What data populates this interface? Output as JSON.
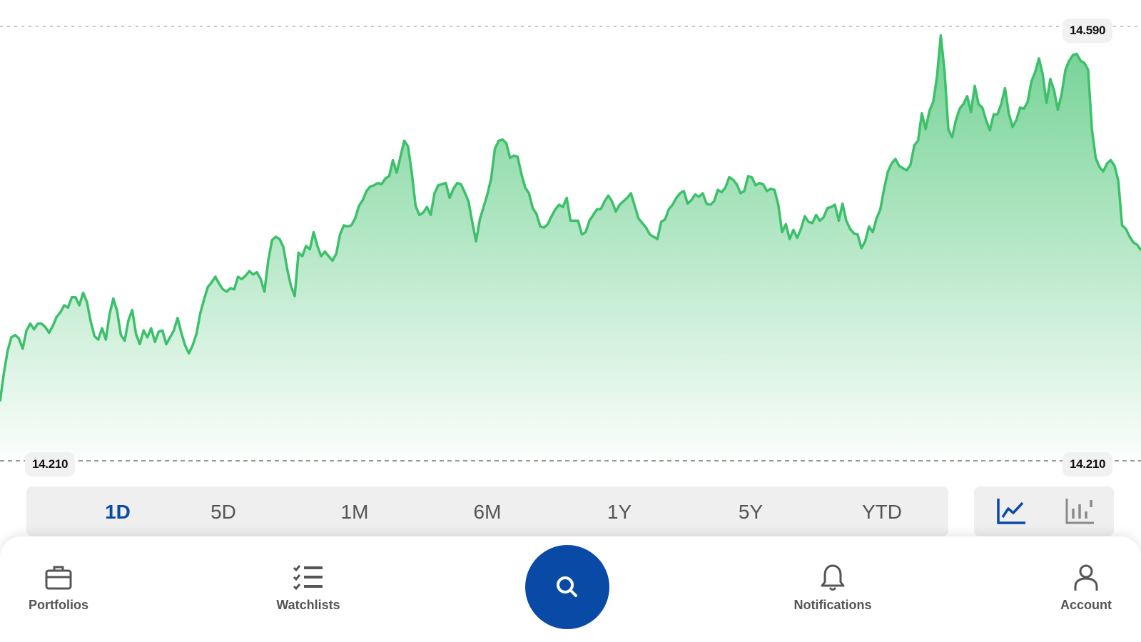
{
  "chart_data": {
    "type": "area",
    "x": [
      0,
      1,
      2,
      3,
      4,
      5,
      6,
      7,
      8,
      9,
      10,
      11,
      12,
      13,
      14,
      15,
      16,
      17,
      18,
      19,
      20,
      21,
      22,
      23,
      24,
      25,
      26,
      27,
      28,
      29,
      30,
      31,
      32,
      33,
      34,
      35,
      36,
      37,
      38,
      39,
      40,
      41,
      42,
      43,
      44,
      45,
      46,
      47,
      48,
      49,
      50,
      51,
      52,
      53,
      54,
      55,
      56,
      57,
      58,
      59,
      60,
      61,
      62,
      63,
      64,
      65,
      66,
      67,
      68,
      69,
      70,
      71,
      72,
      73,
      74,
      75,
      76,
      77,
      78,
      79,
      80,
      81,
      82,
      83,
      84,
      85,
      86,
      87,
      88,
      89,
      90,
      91,
      92,
      93,
      94,
      95,
      96,
      97,
      98,
      99,
      100,
      101,
      102,
      103,
      104,
      105,
      106,
      107,
      108,
      109,
      110,
      111,
      112,
      113,
      114,
      115,
      116,
      117,
      118,
      119,
      120,
      121,
      122,
      123,
      124,
      125,
      126,
      127,
      128,
      129,
      130,
      131,
      132,
      133,
      134,
      135,
      136,
      137,
      138,
      139,
      140,
      141,
      142,
      143,
      144,
      145,
      146,
      147,
      148,
      149,
      150,
      151,
      152,
      153,
      154,
      155,
      156,
      157,
      158,
      159,
      160,
      161,
      162,
      163,
      164,
      165,
      166,
      167,
      168,
      169,
      170,
      171,
      172,
      173,
      174,
      175,
      176,
      177,
      178,
      179,
      180,
      181,
      182,
      183,
      184,
      185,
      186,
      187,
      188,
      189,
      190,
      191,
      192,
      193,
      194,
      195,
      196,
      197,
      198,
      199,
      200,
      201,
      202,
      203,
      204,
      205,
      206,
      207,
      208,
      209,
      210,
      211,
      212,
      213,
      214,
      215,
      216,
      217,
      218,
      219,
      220,
      221,
      222,
      223,
      224,
      225,
      226,
      227,
      228,
      229,
      230,
      231,
      232,
      233,
      234,
      235,
      236,
      237,
      238,
      239,
      240,
      241,
      242,
      243,
      244,
      245,
      246,
      247,
      248,
      249,
      250,
      251,
      252,
      253,
      254,
      255,
      256,
      257,
      258,
      259,
      260,
      261,
      262,
      263,
      264,
      265,
      266,
      267,
      268,
      269,
      270,
      271,
      272,
      273,
      274,
      275,
      276,
      277,
      278,
      279,
      280,
      281,
      282,
      283,
      284,
      285,
      286,
      287,
      288,
      289,
      290,
      291,
      292,
      293,
      294,
      295,
      296,
      297,
      298,
      299
    ],
    "values": [
      14.262,
      14.286,
      14.306,
      14.318,
      14.32,
      14.317,
      14.308,
      14.324,
      14.33,
      14.325,
      14.33,
      14.33,
      14.327,
      14.322,
      14.328,
      14.336,
      14.34,
      14.346,
      14.344,
      14.353,
      14.353,
      14.346,
      14.357,
      14.349,
      14.332,
      14.319,
      14.316,
      14.326,
      14.316,
      14.338,
      14.352,
      14.341,
      14.32,
      14.315,
      14.333,
      14.342,
      14.321,
      14.312,
      14.324,
      14.318,
      14.326,
      14.314,
      14.323,
      14.324,
      14.312,
      14.318,
      14.324,
      14.335,
      14.322,
      14.311,
      14.304,
      14.311,
      14.321,
      14.339,
      14.351,
      14.362,
      14.366,
      14.371,
      14.365,
      14.36,
      14.358,
      14.361,
      14.36,
      14.371,
      14.369,
      14.372,
      14.376,
      14.373,
      14.375,
      14.369,
      14.358,
      14.385,
      14.403,
      14.406,
      14.404,
      14.397,
      14.378,
      14.363,
      14.354,
      14.392,
      14.389,
      14.398,
      14.395,
      14.41,
      14.398,
      14.389,
      14.393,
      14.389,
      14.385,
      14.391,
      14.408,
      14.416,
      14.415,
      14.416,
      14.422,
      14.433,
      14.438,
      14.446,
      14.45,
      14.451,
      14.453,
      14.452,
      14.457,
      14.459,
      14.473,
      14.462,
      14.476,
      14.49,
      14.485,
      14.462,
      14.433,
      14.425,
      14.427,
      14.432,
      14.425,
      14.444,
      14.451,
      14.452,
      14.453,
      14.44,
      14.448,
      14.453,
      14.452,
      14.445,
      14.437,
      14.419,
      14.402,
      14.421,
      14.432,
      14.443,
      14.457,
      14.483,
      14.49,
      14.491,
      14.488,
      14.475,
      14.477,
      14.476,
      14.461,
      14.449,
      14.444,
      14.431,
      14.426,
      14.415,
      14.414,
      14.417,
      14.424,
      14.43,
      14.434,
      14.432,
      14.44,
      14.42,
      14.42,
      14.42,
      14.408,
      14.41,
      14.42,
      14.425,
      14.43,
      14.43,
      14.437,
      14.442,
      14.437,
      14.428,
      14.434,
      14.437,
      14.44,
      14.444,
      14.433,
      14.422,
      14.418,
      14.414,
      14.408,
      14.406,
      14.404,
      14.419,
      14.421,
      14.43,
      14.434,
      14.44,
      14.444,
      14.446,
      14.435,
      14.438,
      14.443,
      14.441,
      14.444,
      14.435,
      14.434,
      14.437,
      14.447,
      14.445,
      14.449,
      14.458,
      14.456,
      14.452,
      14.444,
      14.446,
      14.459,
      14.458,
      14.451,
      14.453,
      14.452,
      14.446,
      14.448,
      14.447,
      14.434,
      14.41,
      14.417,
      14.404,
      14.412,
      14.405,
      14.413,
      14.424,
      14.419,
      14.418,
      14.425,
      14.42,
      14.423,
      14.431,
      14.432,
      14.434,
      14.42,
      14.435,
      14.42,
      14.413,
      14.409,
      14.408,
      14.396,
      14.402,
      14.415,
      14.41,
      14.422,
      14.43,
      14.448,
      14.463,
      14.47,
      14.474,
      14.468,
      14.466,
      14.464,
      14.469,
      14.486,
      14.49,
      14.514,
      14.5,
      14.516,
      14.524,
      14.546,
      14.582,
      14.551,
      14.5,
      14.493,
      14.508,
      14.518,
      14.522,
      14.529,
      14.515,
      14.538,
      14.522,
      14.519,
      14.508,
      14.499,
      14.513,
      14.513,
      14.522,
      14.536,
      14.514,
      14.502,
      14.508,
      14.519,
      14.518,
      14.524,
      14.542,
      14.55,
      14.562,
      14.548,
      14.523,
      14.544,
      14.534,
      14.517,
      14.531,
      14.552,
      14.56,
      14.565,
      14.566,
      14.56,
      14.558,
      14.552,
      14.5,
      14.475,
      14.467,
      14.463,
      14.47,
      14.473,
      14.468,
      14.455,
      14.416,
      14.413,
      14.406,
      14.401,
      14.399,
      14.394
    ],
    "ylim": [
      14.21,
      14.59
    ],
    "y_max_label": "14.590",
    "y_min_label": "14.210",
    "line_color": "#3cc06a",
    "fill_color": "#3cc06a"
  },
  "range_selector": {
    "items": [
      "1D",
      "5D",
      "1M",
      "6M",
      "1Y",
      "5Y",
      "YTD"
    ],
    "active": "1D"
  },
  "chart_type_toggle": {
    "options": [
      "line-chart-icon",
      "bar-chart-icon"
    ],
    "active": "line-chart-icon"
  },
  "bottom_nav": {
    "portfolios": "Portfolios",
    "watchlists": "Watchlists",
    "notifications": "Notifications",
    "account": "Account",
    "search_icon": "search-icon"
  },
  "colors": {
    "accent": "#0a4aa7",
    "chart_green": "#3cc06a"
  }
}
